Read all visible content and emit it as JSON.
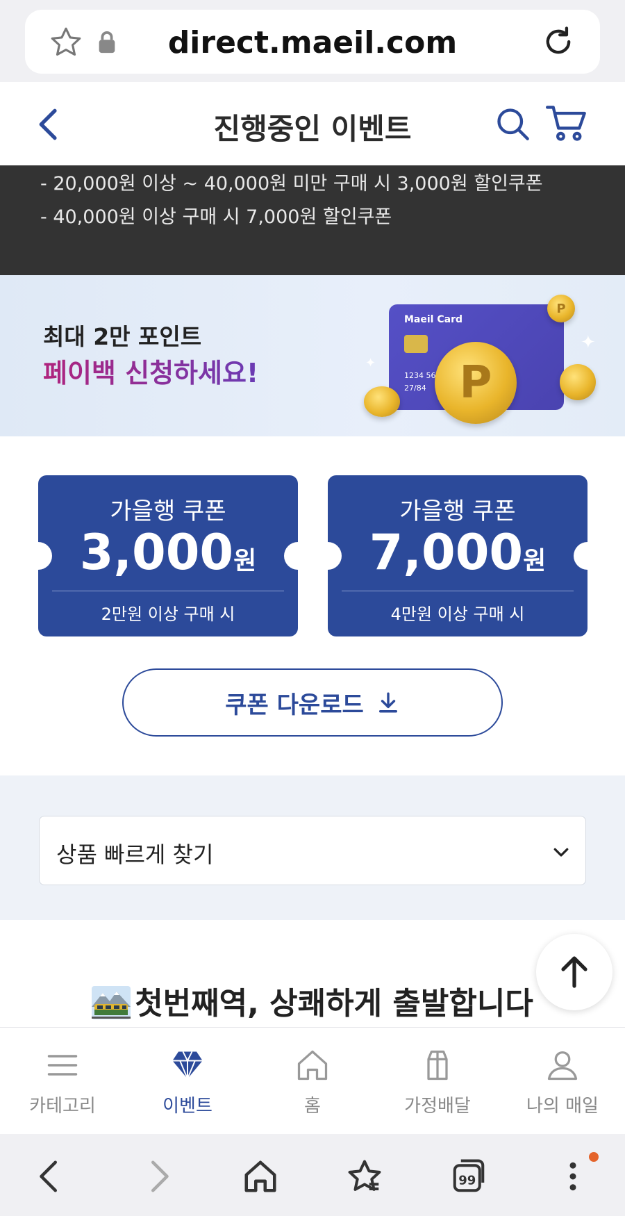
{
  "browser": {
    "url": "direct.maeil.com",
    "tabs_count": "99"
  },
  "header": {
    "title": "진행중인 이벤트"
  },
  "notice": {
    "line1": "- 20,000원 이상 ~ 40,000원 미만 구매 시 3,000원 할인쿠폰",
    "line2": "- 40,000원 이상 구매 시 7,000원 할인쿠폰"
  },
  "banner": {
    "line1": "최대 2만 포인트",
    "line2": "페이백 신청하세요!",
    "card_brand": "Maeil Card",
    "card_number": "1234  56",
    "card_expiry": "27/84",
    "coin_letter": "P"
  },
  "coupons": [
    {
      "title": "가을행 쿠폰",
      "amount": "3,000",
      "unit": "원",
      "note": "2만원 이상 구매 시"
    },
    {
      "title": "가을행 쿠폰",
      "amount": "7,000",
      "unit": "원",
      "note": "4만원 이상 구매 시"
    }
  ],
  "download_button": {
    "label": "쿠폰 다운로드"
  },
  "quick_find": {
    "label": "상품 빠르게 찾기"
  },
  "section": {
    "heading": "첫번째역, 상쾌하게 출발합니다"
  },
  "tabbar": [
    {
      "label": "카테고리",
      "icon": "menu-icon"
    },
    {
      "label": "이벤트",
      "icon": "diamond-icon",
      "active": true
    },
    {
      "label": "홈",
      "icon": "home-icon"
    },
    {
      "label": "가정배달",
      "icon": "milk-carton-icon"
    },
    {
      "label": "나의 매일",
      "icon": "person-icon"
    }
  ],
  "colors": {
    "brand_blue": "#2c4a9a",
    "notice_bg": "#333333",
    "notification_dot": "#e4642b"
  }
}
